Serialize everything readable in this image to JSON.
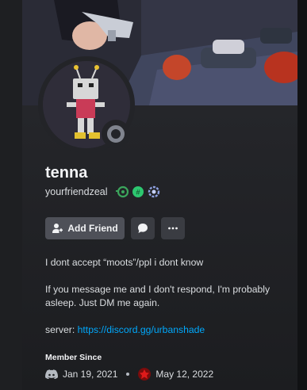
{
  "profile": {
    "display_name": "tenna",
    "username": "yourfriendzeal",
    "badges": [
      "nitro-badge",
      "hypesquad-badge",
      "boost-badge"
    ],
    "status": "offline"
  },
  "actions": {
    "add_friend_label": "Add Friend",
    "message_icon": "chat-bubble-icon",
    "more_icon": "ellipsis-icon"
  },
  "bio": {
    "line1": "I dont accept “moots”/ppl i dont know",
    "line2": "If you message me and I don't respond, I'm probably asleep. Just DM me again.",
    "server_label": "server: ",
    "server_link": "https://discord.gg/urbanshade"
  },
  "member_since": {
    "label": "Member Since",
    "discord_date": "Jan 19, 2021",
    "server_date": "May 12, 2022"
  },
  "colors": {
    "link": "#00a8fc",
    "button": "#4e5058",
    "status_offline": "#80848e"
  }
}
